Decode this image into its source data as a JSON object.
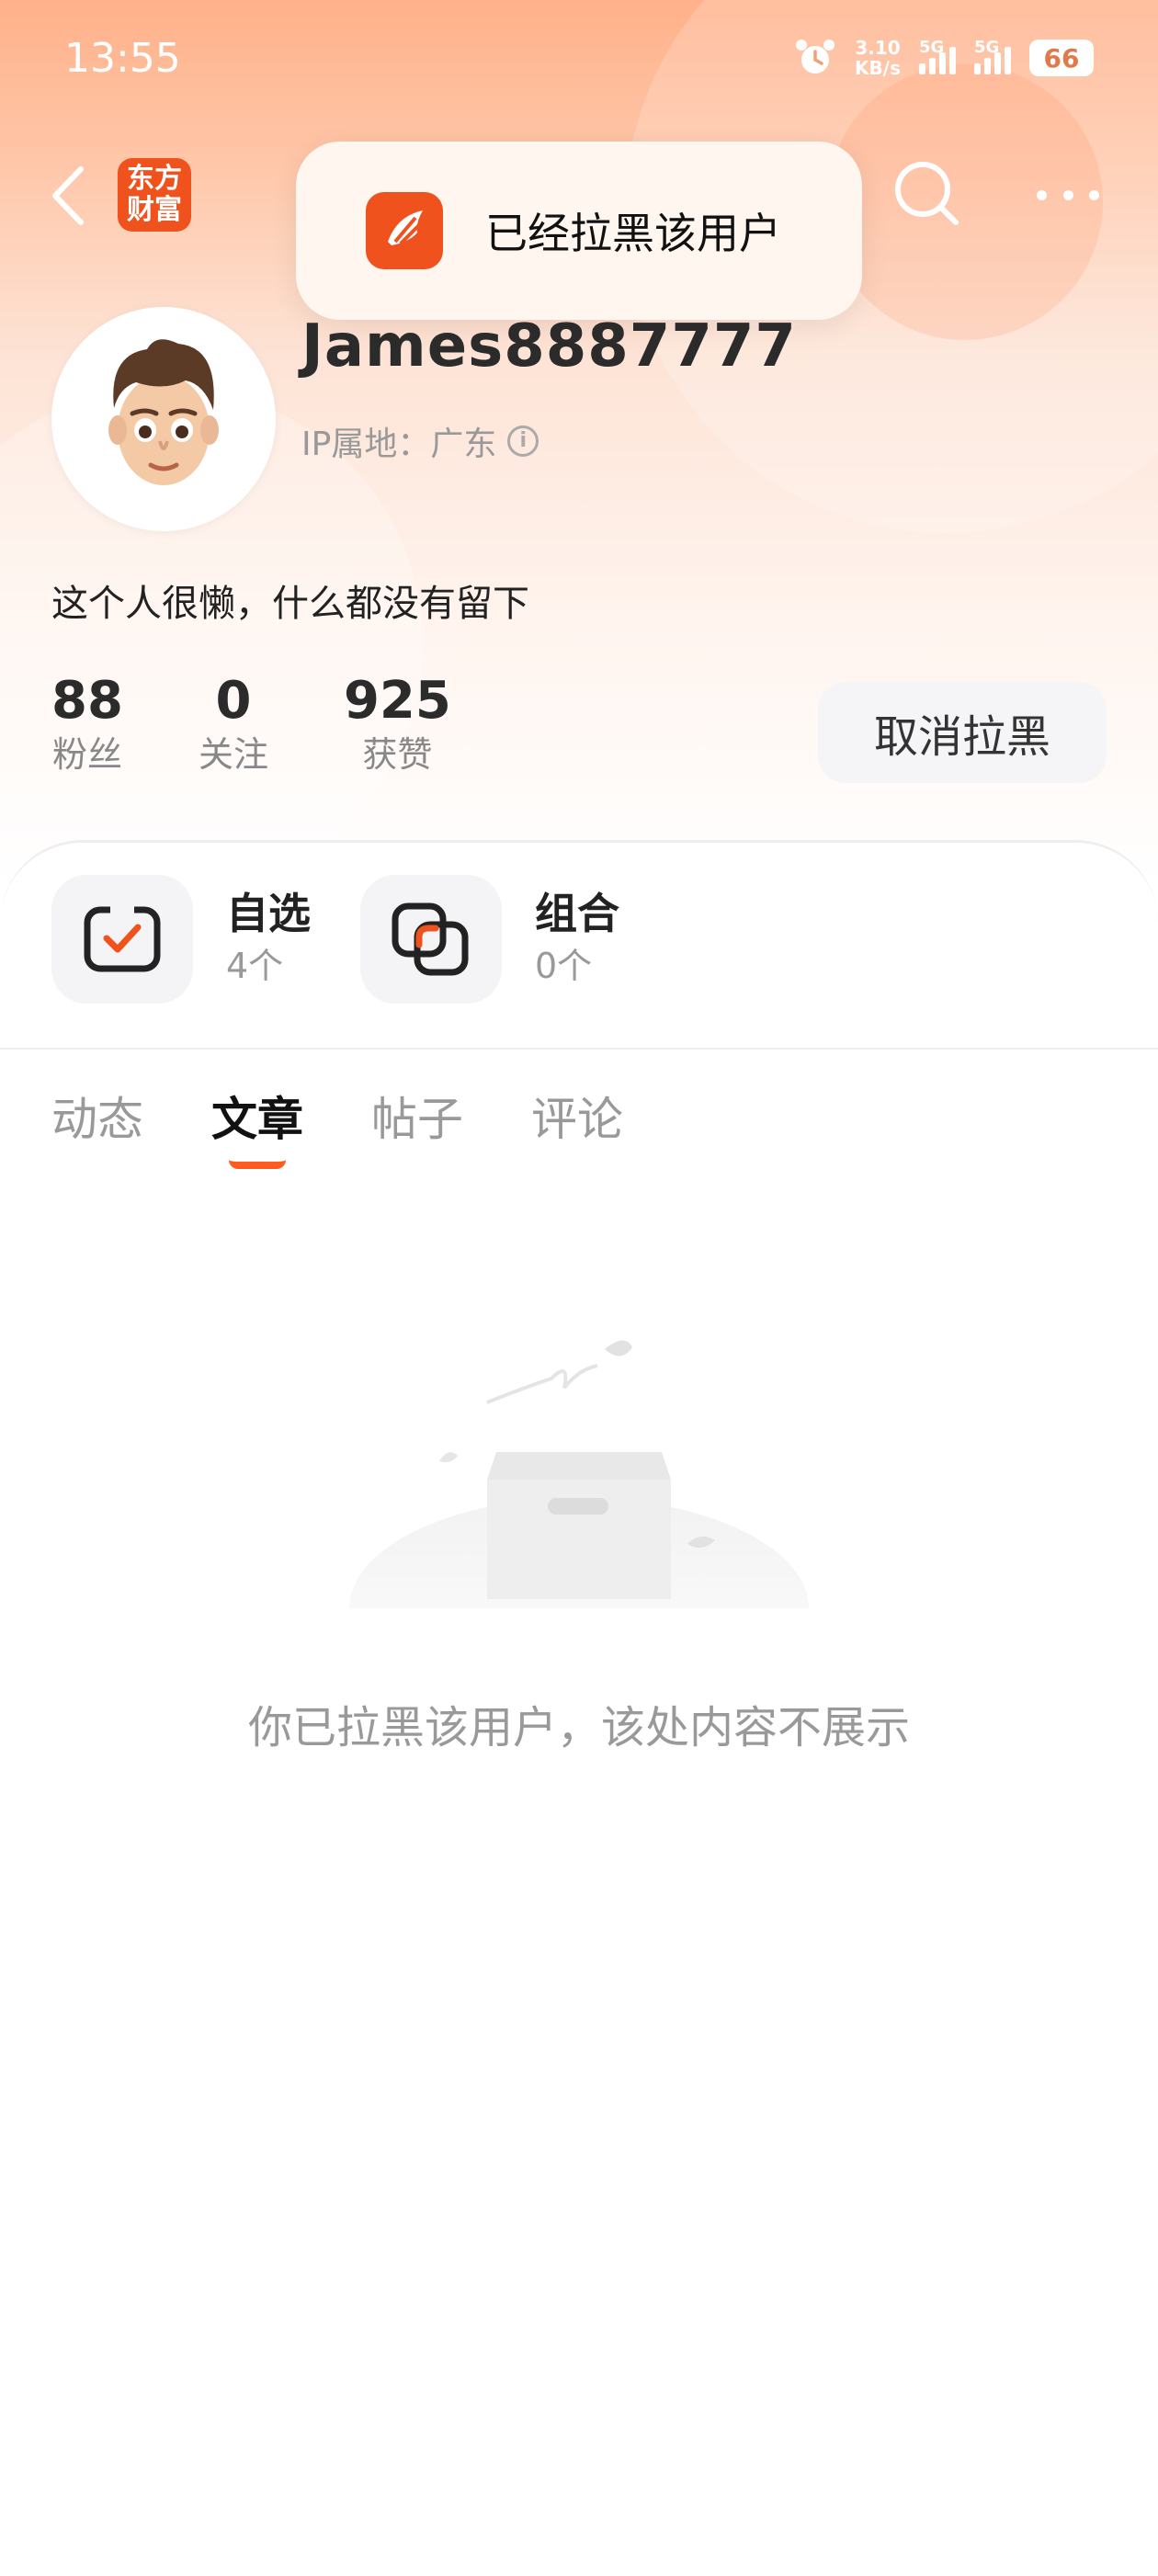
{
  "status_bar": {
    "time": "13:55",
    "speed_value": "3.10",
    "speed_unit": "KB/s",
    "network1": "5G",
    "network2": "5G",
    "battery": "66"
  },
  "nav": {
    "logo_line1": "东方",
    "logo_line2": "财富"
  },
  "toast": {
    "text": "已经拉黑该用户"
  },
  "profile": {
    "username": "James8887777",
    "ip_location": "IP属地：广东",
    "bio": "这个人很懒，什么都没有留下",
    "stats": [
      {
        "value": "88",
        "label": "粉丝"
      },
      {
        "value": "0",
        "label": "关注"
      },
      {
        "value": "925",
        "label": "获赞"
      }
    ],
    "unblock_label": "取消拉黑"
  },
  "features": [
    {
      "title": "自选",
      "count": "4个"
    },
    {
      "title": "组合",
      "count": "0个"
    }
  ],
  "tabs": [
    {
      "label": "动态",
      "active": false
    },
    {
      "label": "文章",
      "active": true
    },
    {
      "label": "帖子",
      "active": false
    },
    {
      "label": "评论",
      "active": false
    }
  ],
  "empty_state": {
    "message": "你已拉黑该用户，该处内容不展示"
  },
  "colors": {
    "brand": "#f0521e",
    "accent": "#ff5a1f"
  }
}
